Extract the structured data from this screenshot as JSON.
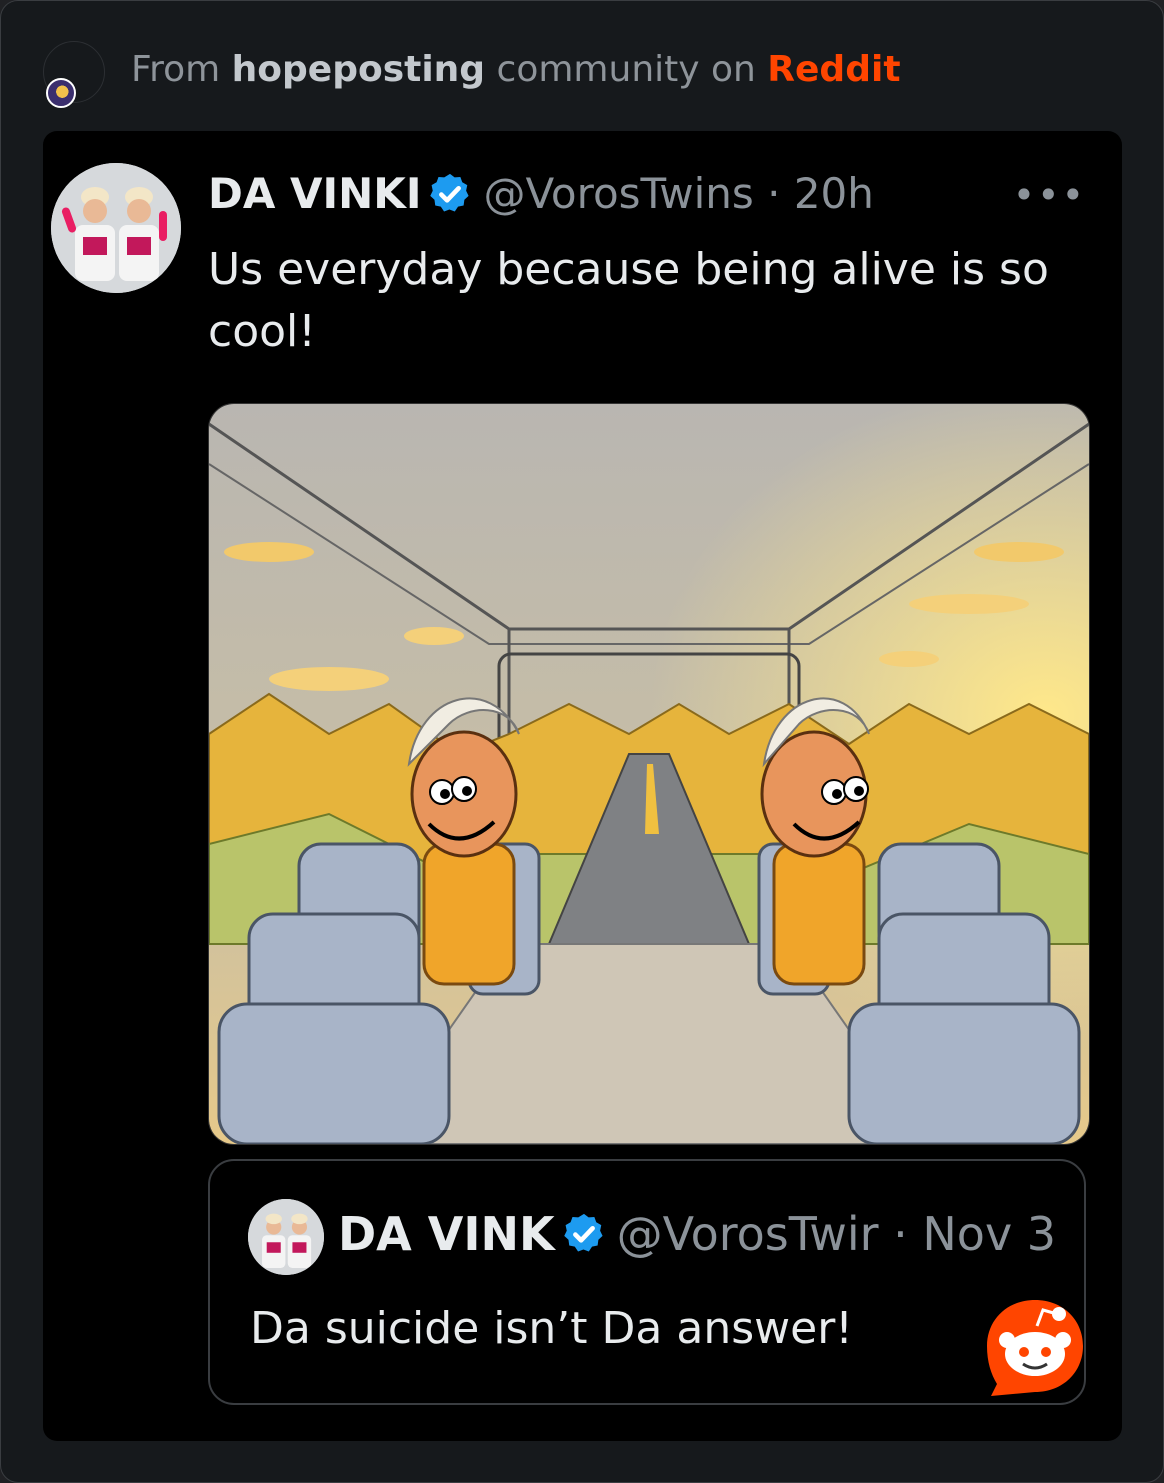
{
  "header": {
    "prefix": "From",
    "community": "hopeposting",
    "middle": "community on",
    "platform": "Reddit"
  },
  "tweet": {
    "name": "DA VINKI",
    "handle_time": "@VorosTwins · 20h",
    "more": "•••",
    "text": "Us everyday because being alive is so cool!"
  },
  "quoted_tweet": {
    "name": "DA VINK",
    "handle_time": "@VorosTwir · Nov 3",
    "text": "Da suicide isn’t Da answer!"
  },
  "colors": {
    "reddit_orange": "#ff4500",
    "verified_blue": "#1d9bf0",
    "text_primary": "#e8ebed",
    "text_secondary": "#8b9299"
  },
  "icons": {
    "verified": "verified-badge-icon",
    "more": "more-options-icon",
    "reddit": "reddit-logo-icon"
  }
}
